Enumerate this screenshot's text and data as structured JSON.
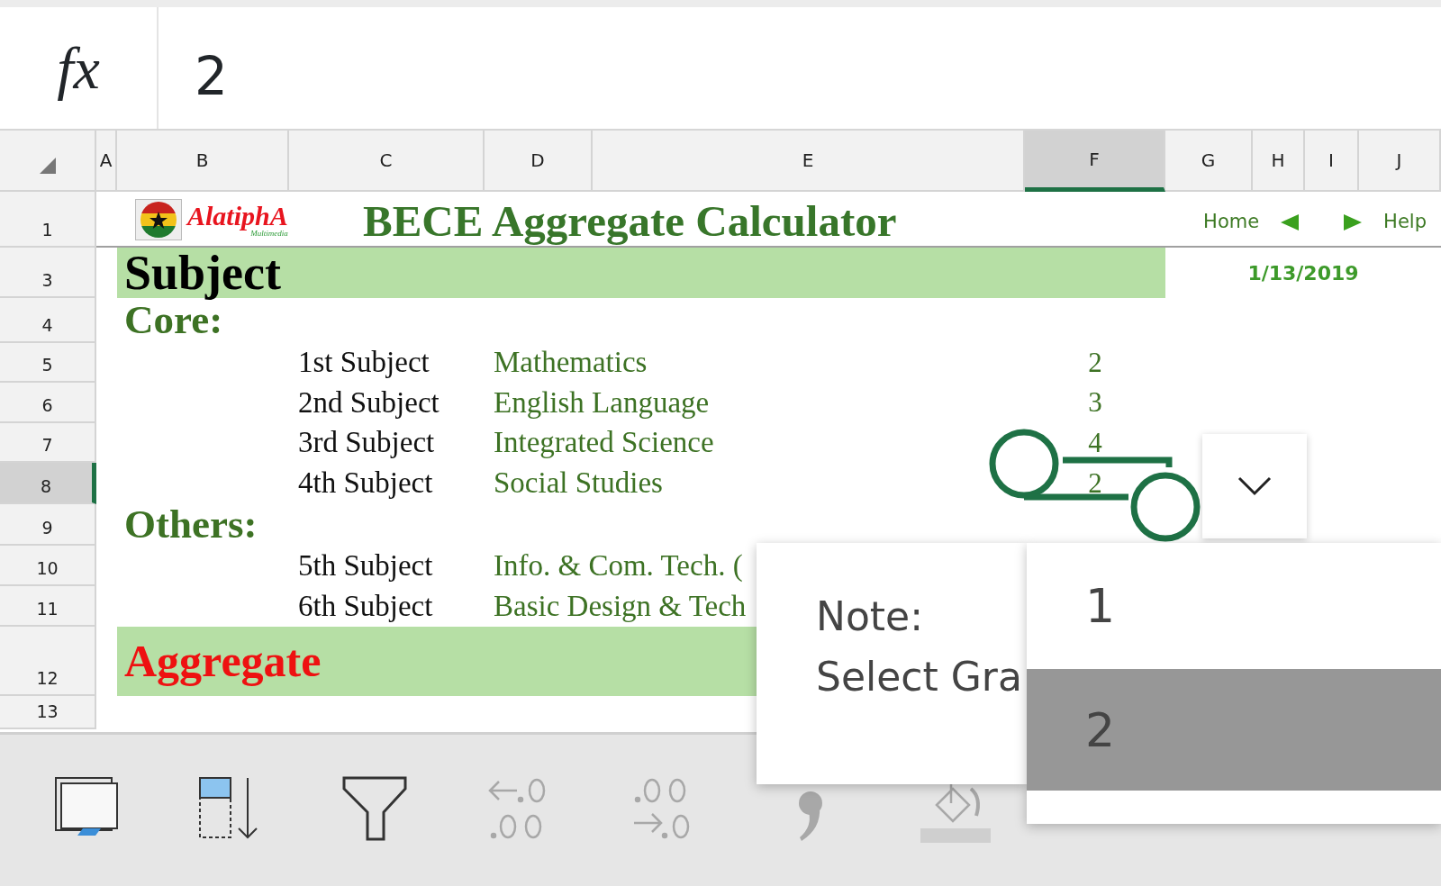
{
  "formula_bar": {
    "fx_label": "fx",
    "value": "2"
  },
  "columns": [
    {
      "label": "A",
      "selected": false
    },
    {
      "label": "B",
      "selected": false
    },
    {
      "label": "C",
      "selected": false
    },
    {
      "label": "D",
      "selected": false
    },
    {
      "label": "E",
      "selected": false
    },
    {
      "label": "F",
      "selected": true
    },
    {
      "label": "G",
      "selected": false
    },
    {
      "label": "H",
      "selected": false
    },
    {
      "label": "I",
      "selected": false
    },
    {
      "label": "J",
      "selected": false
    }
  ],
  "rows": [
    {
      "label": "1",
      "selected": false
    },
    {
      "label": "3",
      "selected": false
    },
    {
      "label": "4",
      "selected": false
    },
    {
      "label": "5",
      "selected": false
    },
    {
      "label": "6",
      "selected": false
    },
    {
      "label": "7",
      "selected": false
    },
    {
      "label": "8",
      "selected": true
    },
    {
      "label": "9",
      "selected": false
    },
    {
      "label": "10",
      "selected": false
    },
    {
      "label": "11",
      "selected": false
    },
    {
      "label": "12",
      "selected": false
    },
    {
      "label": "13",
      "selected": false
    }
  ],
  "header": {
    "brand": "AlatiphA",
    "brand_sub": "Multimedia",
    "title": "BECE Aggregate Calculator",
    "home": "Home",
    "help": "Help"
  },
  "date": "1/13/2019",
  "subject_heading": "Subject",
  "groups": [
    {
      "heading": "Core:",
      "subjects": [
        {
          "label": "1st Subject",
          "name": "Mathematics",
          "grade": "2"
        },
        {
          "label": "2nd Subject",
          "name": "English Language",
          "grade": "3"
        },
        {
          "label": "3rd Subject",
          "name": "Integrated Science",
          "grade": "4"
        },
        {
          "label": "4th Subject",
          "name": "Social Studies",
          "grade": "2"
        }
      ]
    },
    {
      "heading": "Others:",
      "subjects": [
        {
          "label": "5th Subject",
          "name": "Info. & Com. Tech. ("
        },
        {
          "label": "6th Subject",
          "name": "Basic Design & Tech"
        }
      ]
    }
  ],
  "aggregate_label": "Aggregate",
  "note": {
    "title": "Note:",
    "text": "Select Gra"
  },
  "dropdown": {
    "options": [
      {
        "label": "1",
        "selected": false
      },
      {
        "label": "2",
        "selected": true
      }
    ]
  },
  "toolbar": [
    {
      "kind": "window",
      "disabled": false
    },
    {
      "kind": "fill-down",
      "disabled": false
    },
    {
      "kind": "filter",
      "disabled": false
    },
    {
      "kind": "decrease-decimal",
      "disabled": true
    },
    {
      "kind": "increase-decimal",
      "disabled": true
    },
    {
      "kind": "comma",
      "disabled": true
    },
    {
      "kind": "paint",
      "disabled": true
    }
  ]
}
